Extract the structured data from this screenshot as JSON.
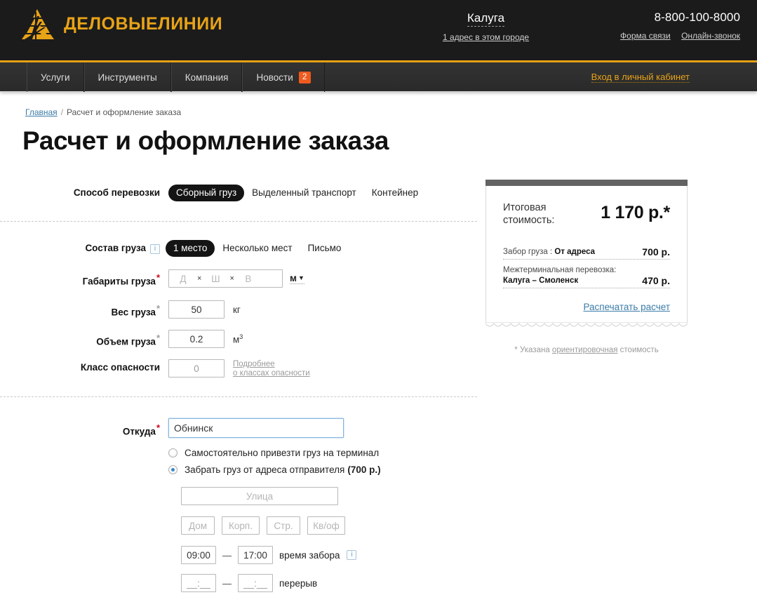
{
  "header": {
    "logo_alt": "Деловые Линии",
    "city": {
      "name": "Калуга",
      "sub": "1 адрес в этом городе"
    },
    "phone": "8-800-100-8000",
    "links": [
      "Форма связи",
      "Онлайн-звонок"
    ]
  },
  "nav": {
    "items": [
      {
        "label": "Услуги",
        "badge": ""
      },
      {
        "label": "Инструменты",
        "badge": ""
      },
      {
        "label": "Компания",
        "badge": ""
      },
      {
        "label": "Новости",
        "badge": "2"
      }
    ],
    "login": "Вход в личный кабинет"
  },
  "breadcrumb": {
    "home": "Главная",
    "sep": "/",
    "current": "Расчет и оформление заказа"
  },
  "page_title": "Расчет и оформление заказа",
  "form": {
    "shipping_method": {
      "label": "Способ перевозки",
      "options": [
        "Сборный груз",
        "Выделенный транспорт",
        "Контейнер"
      ],
      "selected": "Сборный груз"
    },
    "cargo_composition": {
      "label": "Состав груза",
      "info": "i",
      "options": [
        "1 место",
        "Несколько мест",
        "Письмо"
      ],
      "selected": "1 место"
    },
    "dimensions": {
      "label": "Габариты груза",
      "required": "*",
      "len_placeholder": "Д",
      "wid_placeholder": "Ш",
      "hei_placeholder": "В",
      "times": "×",
      "unit": "м",
      "caret": "▼"
    },
    "weight": {
      "label": "Вес груза",
      "required": "*",
      "value": "50",
      "unit": "кг"
    },
    "volume": {
      "label": "Объем груза",
      "required": "*",
      "value": "0.2",
      "unit": "м",
      "unit_sup": "3"
    },
    "danger_class": {
      "label": "Класс опасности",
      "value": "0",
      "link_line1": "Подробнее",
      "link_line2": "о классах опасности"
    },
    "origin": {
      "label": "Откуда",
      "required": "*",
      "value": "Обнинск",
      "option_self": "Самостоятельно привезти груз на терминал",
      "option_pickup": "Забрать груз от адреса отправителя",
      "option_pickup_price": "(700 р.)",
      "selected": "pickup",
      "street_placeholder": "Улица",
      "house_placeholder": "Дом",
      "building_placeholder": "Корп.",
      "structure_placeholder": "Стр.",
      "apartment_placeholder": "Кв/оф",
      "pickup_from": "09:00",
      "pickup_to": "17:00",
      "pickup_caption": "время забора",
      "pickup_info": "i",
      "break_from": "__:__",
      "break_to": "__:__",
      "break_caption": "перерыв",
      "dash": "—"
    }
  },
  "price": {
    "total_label_line1": "Итоговая",
    "total_label_line2": "стоимость:",
    "total_value": "1 170 р.*",
    "lines": [
      {
        "text": "Забор груза : ",
        "bold": "От адреса",
        "value": "700 р."
      },
      {
        "text": "Межтерминальная перевозка:",
        "bold": "Калуга – Смоленск",
        "value": "470 р."
      }
    ],
    "print_link": "Распечатать расчет",
    "note_prefix": "* Указана ",
    "note_underline": "ориентировочная",
    "note_suffix": " стоимость"
  },
  "colors": {
    "brand_gold": "#e8a317",
    "header_bg": "#1b1b1b",
    "nav_bg": "#2d2d2d",
    "badge": "#ef5a1f",
    "link_blue": "#3b7ca8",
    "required_red": "#d0021b",
    "pill_active_bg": "#141414"
  }
}
